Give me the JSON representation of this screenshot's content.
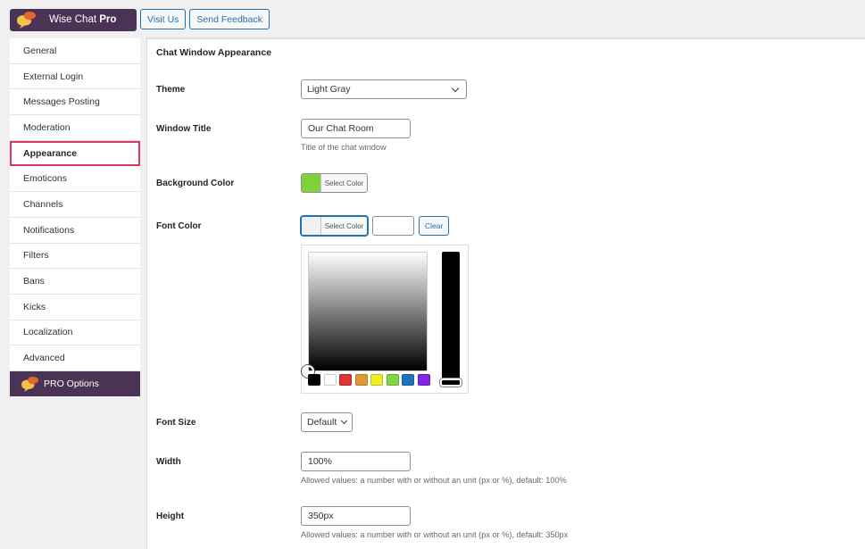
{
  "header": {
    "brand_name": "Wise Chat",
    "brand_suffix": "Pro",
    "buttons": [
      "Visit Us",
      "Send Feedback"
    ]
  },
  "sidebar": {
    "items": [
      {
        "label": "General",
        "active": false
      },
      {
        "label": "External Login",
        "active": false
      },
      {
        "label": "Messages Posting",
        "active": false
      },
      {
        "label": "Moderation",
        "active": false
      },
      {
        "label": "Appearance",
        "active": true
      },
      {
        "label": "Emoticons",
        "active": false
      },
      {
        "label": "Channels",
        "active": false
      },
      {
        "label": "Notifications",
        "active": false
      },
      {
        "label": "Filters",
        "active": false
      },
      {
        "label": "Bans",
        "active": false
      },
      {
        "label": "Kicks",
        "active": false
      },
      {
        "label": "Localization",
        "active": false
      },
      {
        "label": "Advanced",
        "active": false
      }
    ],
    "pro_label": "PRO Options"
  },
  "main": {
    "section_title": "Chat Window Appearance",
    "theme": {
      "label": "Theme",
      "value": "Light Gray"
    },
    "window_title": {
      "label": "Window Title",
      "value": "Our Chat Room",
      "description": "Title of the chat window"
    },
    "background_color": {
      "label": "Background Color",
      "button_label": "Select Color",
      "color": "#7ed23a"
    },
    "font_color": {
      "label": "Font Color",
      "button_label": "Select Color",
      "color": "#f0f0f1",
      "hex_value": "",
      "clear_label": "Clear"
    },
    "palette": [
      "#000000",
      "#ffffff",
      "#dd3333",
      "#dd9933",
      "#eeee22",
      "#81d742",
      "#1e73be",
      "#8224e3"
    ],
    "font_size": {
      "label": "Font Size",
      "value": "Default"
    },
    "width": {
      "label": "Width",
      "value": "100%",
      "description": "Allowed values: a number with or without an unit (px or %), default: 100%"
    },
    "height": {
      "label": "Height",
      "value": "350px",
      "description": "Allowed values: a number with or without an unit (px or %), default: 350px"
    }
  },
  "colors": {
    "brand": "#4a3355",
    "accent": "#2271b1",
    "active_border": "#d63a5a"
  }
}
